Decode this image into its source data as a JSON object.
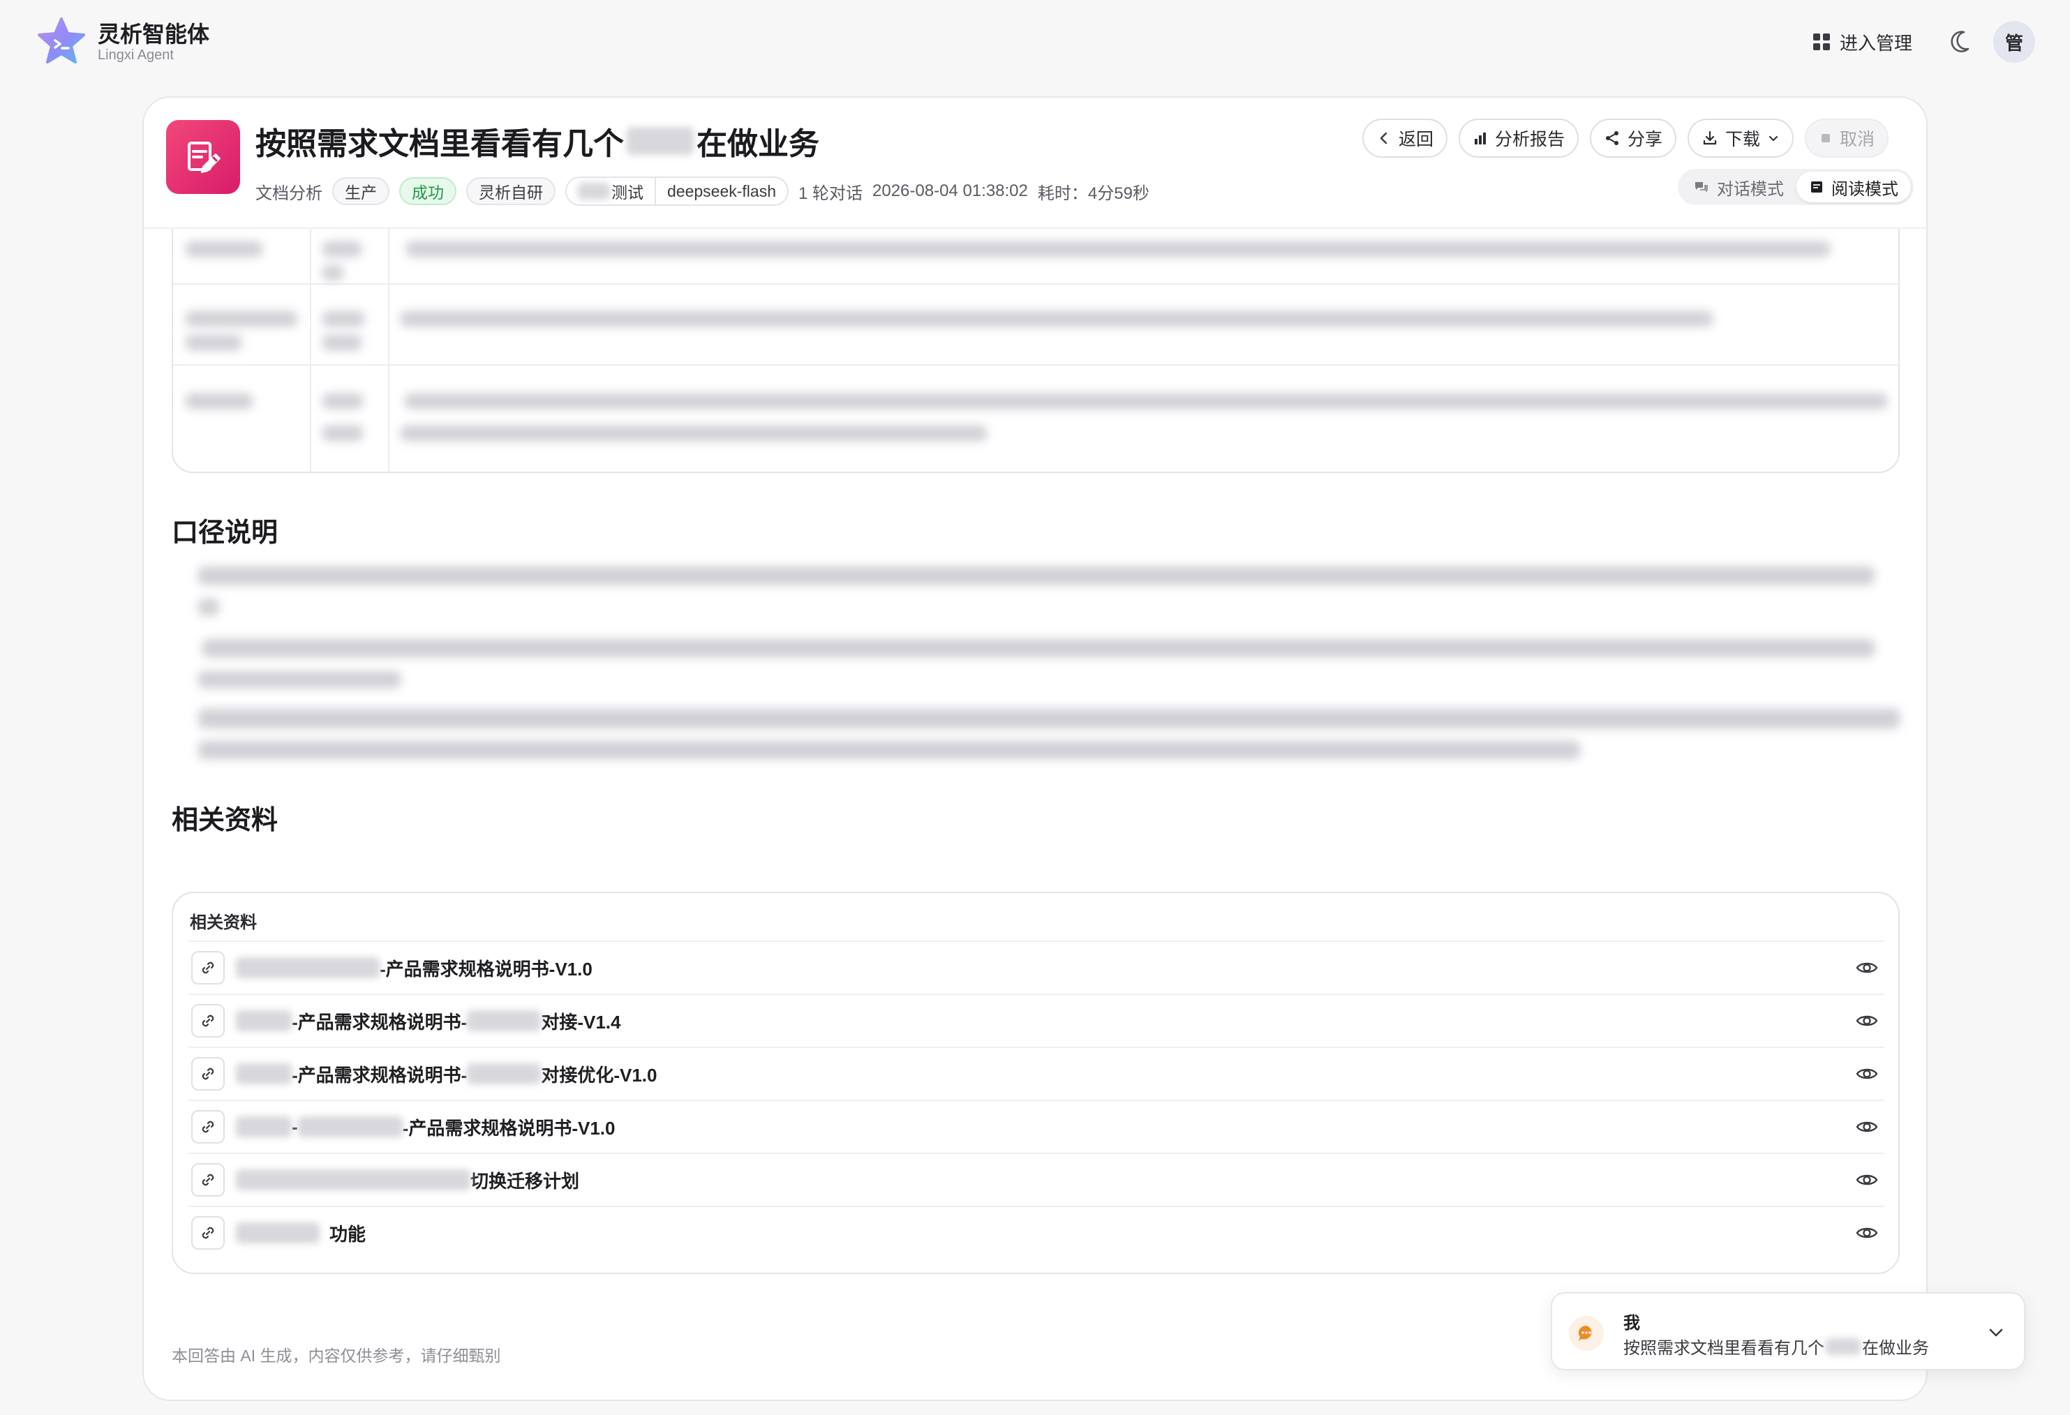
{
  "app": {
    "name": "灵析智能体",
    "subtitle": "Lingxi Agent",
    "admin_label": "进入管理",
    "avatar_text": "管"
  },
  "task": {
    "title_prefix": "按照需求文档里看看有几个",
    "title_suffix": "在做业务",
    "type": "文档分析",
    "tags": [
      "生产",
      "成功",
      "灵析自研"
    ],
    "model_group": [
      "测试",
      "deepseek-flash"
    ],
    "rounds": "1 轮对话",
    "datetime": "2026-08-04 01:38:02",
    "duration": "耗时：4分59秒"
  },
  "actions": {
    "back": "返回",
    "report": "分析报告",
    "share": "分享",
    "download": "下载",
    "cancel": "取消"
  },
  "modes": {
    "chat": "对话模式",
    "read": "阅读模式",
    "active": "read"
  },
  "sections": {
    "caliber_title": "口径说明",
    "related_title": "相关资料"
  },
  "related": {
    "header": "相关资料",
    "items": [
      {
        "visible_text": "-产品需求规格说明书-V1.0"
      },
      {
        "visible_text_a": "-产品需求规格说明书-",
        "visible_text_b": "对接-V1.4"
      },
      {
        "visible_text_a": "-产品需求规格说明书-",
        "visible_text_b": "对接优化-V1.0"
      },
      {
        "visible_text_a": "-",
        "visible_text_b": "-产品需求规格说明书-V1.0"
      },
      {
        "visible_text": "切换迁移计划"
      },
      {
        "visible_text": "功能"
      }
    ]
  },
  "footnote": "本回答由 AI 生成，内容仅供参考，请仔细甄别",
  "chat_popup": {
    "user": "我",
    "msg_prefix": "按照需求文档里看看有几个",
    "msg_suffix": "在做业务"
  },
  "colors": {
    "accent_pink": "#e0246f",
    "success_green": "#1f9a46",
    "chat_orange": "#f08a24"
  }
}
